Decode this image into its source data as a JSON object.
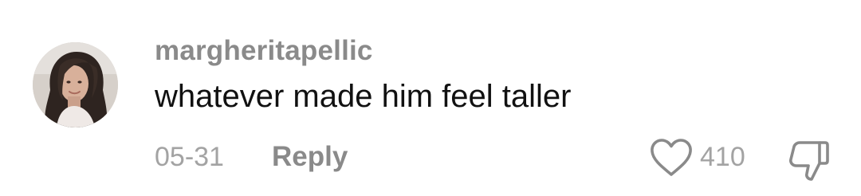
{
  "comment": {
    "username": "margheritapellic",
    "text": "whatever made him feel taller",
    "date": "05-31",
    "reply_label": "Reply",
    "like_count": "410",
    "icons": {
      "avatar": "user-avatar-photo",
      "like": "heart-outline-icon",
      "dislike": "thumbs-down-outline-icon"
    },
    "colors": {
      "username": "#8a8a8a",
      "text": "#111111",
      "meta": "#a3a3a3",
      "icon": "#8a8a8a"
    }
  }
}
